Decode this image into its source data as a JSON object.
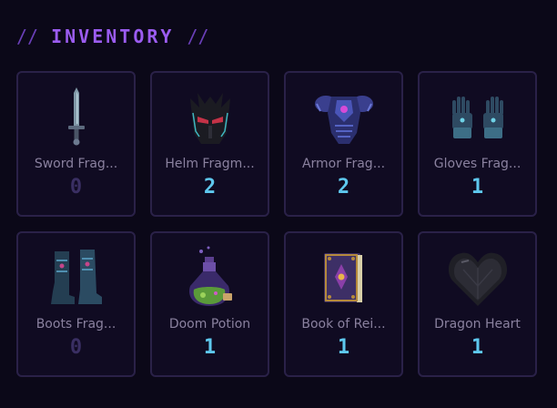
{
  "header": {
    "left_deco": "//",
    "title": "INVENTORY",
    "right_deco": "//"
  },
  "colors": {
    "accent": "#9b5cf0",
    "count": "#5ec8ee",
    "count_zero": "#3a2f63",
    "card_border": "#2a2148"
  },
  "items": [
    {
      "name": "Sword Frag...",
      "count": "0",
      "icon": "sword-icon"
    },
    {
      "name": "Helm Fragm...",
      "count": "2",
      "icon": "helm-icon"
    },
    {
      "name": "Armor Frag...",
      "count": "2",
      "icon": "armor-icon"
    },
    {
      "name": "Gloves Frag...",
      "count": "1",
      "icon": "gloves-icon"
    },
    {
      "name": "Boots Frag...",
      "count": "0",
      "icon": "boots-icon"
    },
    {
      "name": "Doom Potion",
      "count": "1",
      "icon": "potion-icon"
    },
    {
      "name": "Book of Rei...",
      "count": "1",
      "icon": "book-icon"
    },
    {
      "name": "Dragon Heart",
      "count": "1",
      "icon": "heart-icon"
    }
  ]
}
